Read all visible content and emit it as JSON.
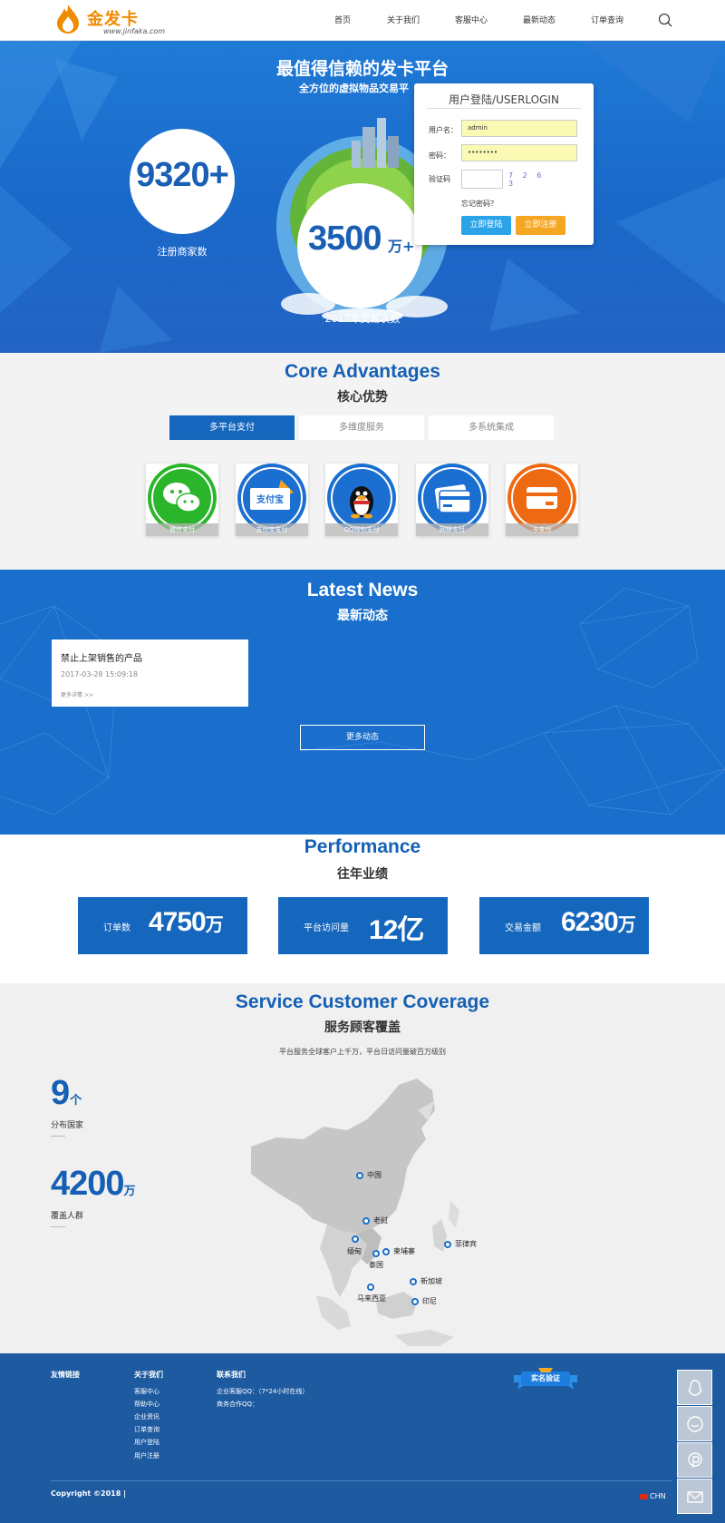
{
  "header": {
    "brand": "金发卡",
    "url": "www.jinfaka.com",
    "nav": [
      "首页",
      "关于我们",
      "客服中心",
      "最新动态",
      "订单查询"
    ]
  },
  "hero": {
    "title": "最值得信赖的发卡平台",
    "subtitle": "全方位的虚拟物品交易平",
    "stat1_value": "9320+",
    "stat1_label": "注册商家数",
    "stat2_value": "3500",
    "stat2_unit": "万+",
    "stat2_label": "2017年交易次数"
  },
  "login": {
    "title": "用户登陆/USERLOGIN",
    "username_label": "用户名：",
    "username_value": "admin",
    "password_label": "密码：",
    "password_value": "••••••••",
    "captcha_label": "验证码",
    "captcha_text": "7 2 6 3",
    "forgot": "忘记密码？",
    "login_btn": "立即登陆",
    "register_btn": "立即注册"
  },
  "advantages": {
    "title_en": "Core Advantages",
    "title_cn": "核心优势",
    "tabs": [
      "多平台支付",
      "多维度服务",
      "多系统集成"
    ],
    "payments": [
      {
        "label": "微信支付",
        "color": "#2bb52b"
      },
      {
        "label": "支付宝支付",
        "color": "#1b6fd0",
        "text": "支付宝"
      },
      {
        "label": "QQ钱包支付",
        "color": "#1b6fd0"
      },
      {
        "label": "网银支付",
        "color": "#1b6fd0"
      },
      {
        "label": "卡支付",
        "color": "#ee6a12"
      }
    ]
  },
  "news": {
    "title_en": "Latest News",
    "title_cn": "最新动态",
    "item_title": "禁止上架销售的产品",
    "item_date": "2017-03-28 15:09:18",
    "item_more": "更多详情 >>",
    "more_btn": "更多动态"
  },
  "performance": {
    "title_en": "Performance",
    "title_cn": "往年业绩",
    "items": [
      {
        "label": "订单数",
        "value": "4750",
        "unit": "万"
      },
      {
        "label": "平台访问量",
        "value": "12亿次",
        "unit": ""
      },
      {
        "label": "交易金额",
        "value": "6230",
        "unit": "万"
      }
    ]
  },
  "coverage": {
    "title_en": "Service Customer Coverage",
    "title_cn": "服务顾客覆盖",
    "subtitle": "平台服务全球客户上千万，平台日访问量破百万级别",
    "countries_value": "9",
    "countries_unit": "个",
    "countries_label": "分布国家",
    "people_value": "4200",
    "people_unit": "万",
    "people_label": "覆盖人群",
    "pins": [
      "中国",
      "老挝",
      "缅甸",
      "柬埔寨",
      "泰国",
      "菲律宾",
      "新加坡",
      "马来西亚",
      "印尼"
    ]
  },
  "footer": {
    "col1_title": "友情链接",
    "col2_title": "关于我们",
    "col2_items": [
      "客服中心",
      "帮助中心",
      "企业资讯",
      "订单查询",
      "用户登陆",
      "用户注册"
    ],
    "col3_title": "联系我们",
    "col3_items": [
      "企业客服QQ：（7*24小时在线）",
      "商务合作QQ："
    ],
    "badge": "实名验证",
    "copyright": "Copyright ©2018 |",
    "lang": "CHN"
  }
}
